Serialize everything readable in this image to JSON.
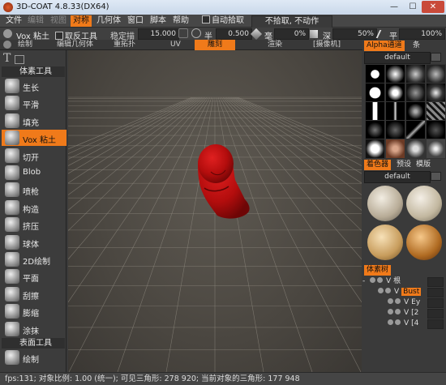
{
  "window": {
    "title": "3D-COAT 4.8.33(DX64)",
    "minimize": "—",
    "maximize": "☐",
    "close": "✕"
  },
  "menubar": {
    "items": [
      "文件",
      "编辑",
      "视图",
      "对称",
      "几何体",
      "窗口",
      "脚本",
      "帮助"
    ],
    "auto_pick_label": "自动拾取",
    "no_pick_label": "不拾取, 不动作"
  },
  "toolbar2": {
    "tool_name": "Vox 粘土",
    "anti_tool_label": "取反工具",
    "fixed_tracing_label": "稳定描",
    "fixed_tracing_value": "15.000",
    "radius_label": "半",
    "radius_value": "0.500",
    "depth_label": "毫",
    "depth_value": "0%",
    "deep_label": "深",
    "deep_value": "50%",
    "smooth_label": "平",
    "smooth_value": "100%"
  },
  "rooms": {
    "items": [
      "绘制",
      "编辑几何体",
      "重拓扑",
      "UV",
      "雕刻",
      "渲染",
      "[摄像机]"
    ],
    "active": "雕刻"
  },
  "left_panel": {
    "section1": "体素工具",
    "tools": [
      "生长",
      "平滑",
      "填充",
      "Vox 粘土",
      "切开",
      "Blob",
      "喷枪",
      "构造",
      "挤压",
      "球体",
      "2D绘制",
      "平面",
      "刮擦",
      "膨缩",
      "涂抹"
    ],
    "active_tool": "Vox 粘土",
    "section2": "表面工具",
    "tools2": [
      "绘制"
    ]
  },
  "right_panel": {
    "alpha_tab": "Alpha通道",
    "alpha_tab2": "条",
    "alpha_preset": "default",
    "material_tabs": [
      "着色器",
      "预设",
      "模版"
    ],
    "material_preset": "default",
    "tree_tab": "体素树",
    "tree_items": [
      {
        "label": "根"
      },
      {
        "label": "Bust"
      },
      {
        "label": "Ey"
      },
      {
        "label": "[2"
      },
      {
        "label": "[4"
      }
    ]
  },
  "statusbar": {
    "text": "fps:131;   对象比例: 1.00 (统一);   可见三角形: 278 920;   当前对象的三角形: 177 948"
  },
  "colors": {
    "accent": "#f07a1a",
    "model": "#c41010"
  }
}
